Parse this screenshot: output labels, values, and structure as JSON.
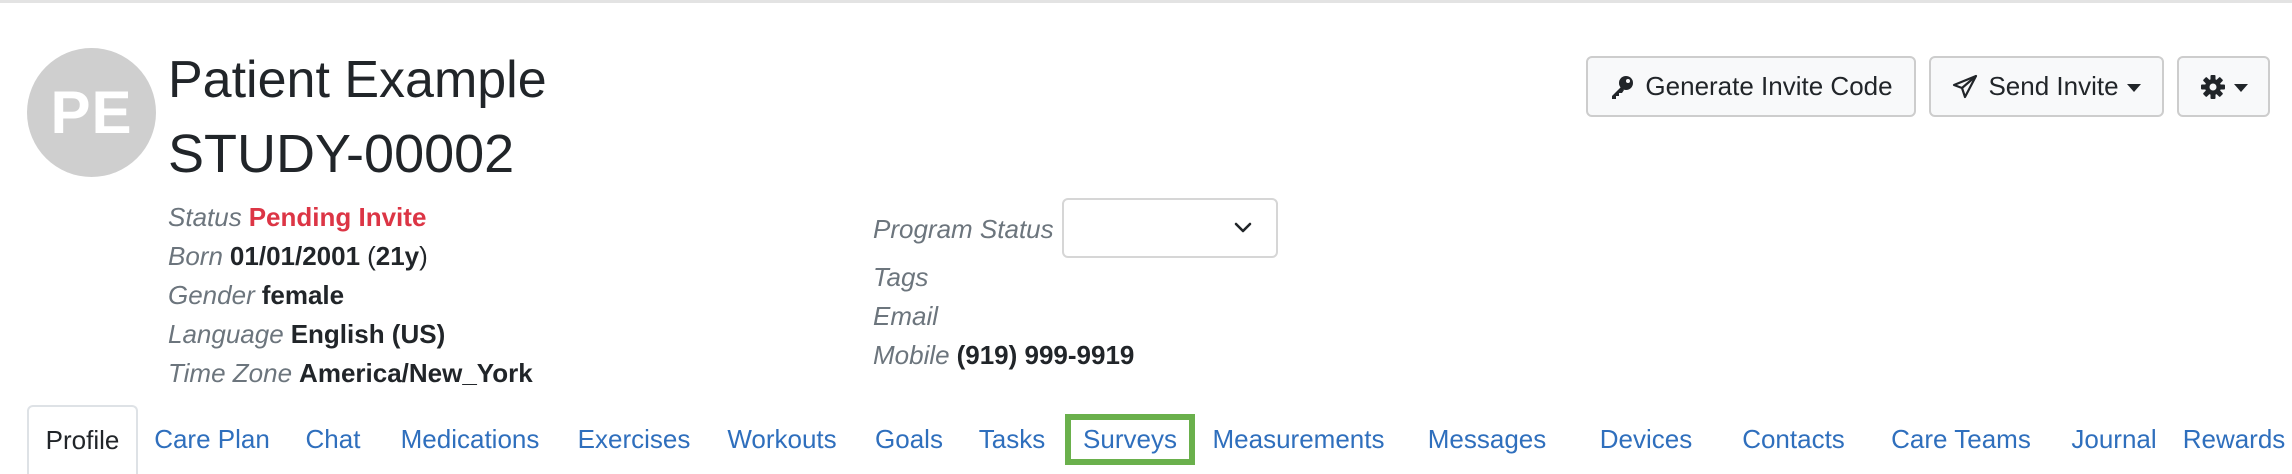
{
  "patient": {
    "initials": "PE",
    "name": "Patient Example",
    "study_id": "STUDY-00002"
  },
  "details_left": {
    "status_label": "Status",
    "status_value": "Pending Invite",
    "born_label": "Born",
    "born_date": "01/01/2001",
    "born_open": "(",
    "born_age": "21y",
    "born_close": ")",
    "gender_label": "Gender",
    "gender_value": "female",
    "language_label": "Language",
    "language_value": "English (US)",
    "timezone_label": "Time Zone",
    "timezone_value": "America/New_York"
  },
  "details_right": {
    "program_status_label": "Program Status",
    "program_status_value": "",
    "tags_label": "Tags",
    "email_label": "Email",
    "mobile_label": "Mobile",
    "mobile_value": "(919) 999-9919"
  },
  "actions": {
    "generate_invite_code": "Generate Invite Code",
    "send_invite": "Send Invite"
  },
  "icons": {
    "key": "key-icon",
    "send": "paper-plane-icon",
    "settings": "gear-icon",
    "select": "chevron-down-icon"
  },
  "tabs": [
    {
      "label": "Profile",
      "active": true
    },
    {
      "label": "Care Plan"
    },
    {
      "label": "Chat"
    },
    {
      "label": "Medications"
    },
    {
      "label": "Exercises"
    },
    {
      "label": "Workouts"
    },
    {
      "label": "Goals"
    },
    {
      "label": "Tasks"
    },
    {
      "label": "Surveys",
      "highlighted": true
    },
    {
      "label": "Measurements"
    },
    {
      "label": "Messages"
    },
    {
      "label": "Devices"
    },
    {
      "label": "Contacts"
    },
    {
      "label": "Care Teams"
    },
    {
      "label": "Journal"
    },
    {
      "label": "Rewards"
    }
  ],
  "colors": {
    "link": "#2f6fbd",
    "danger": "#dc3545",
    "muted": "#6c757d",
    "highlight": "#6ab04c",
    "avatar": "#cfcfcf"
  }
}
